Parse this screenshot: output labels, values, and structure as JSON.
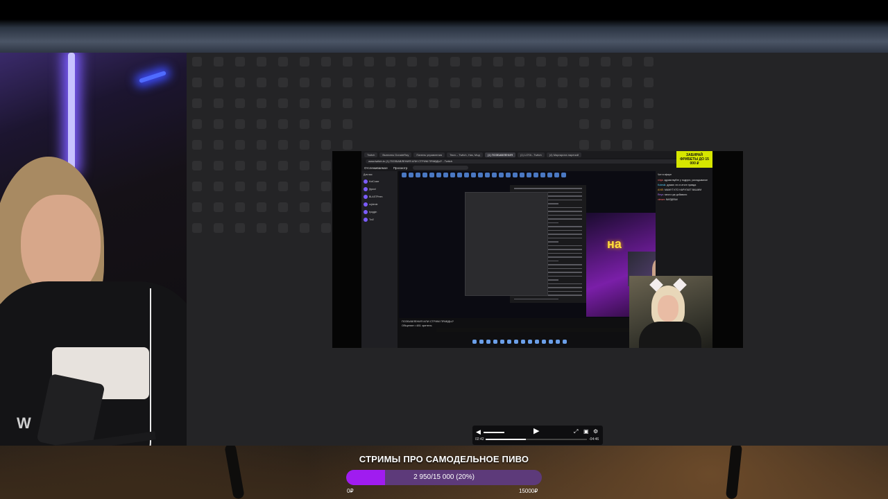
{
  "capture": {
    "tabs": [
      "Twitch",
      "Выплаты DonateRay",
      "Панель управления",
      "Твич – Twitch, Ник, Мод",
      "(1) ПОЗБАВЛЕНИЯ",
      "(1) LOTA - Twitch",
      "(4) Маргарита наречий"
    ],
    "url": "www.twitch.tv",
    "page_title": "(1) ПОЗБАВЛЕНИЯ ИЛИ СТРИМ ПРАВДЫ? - Twitch",
    "ad_text": "ЗАБИРАЙ ФРИБЕТЫ ДО 15 000 ₽",
    "nav": [
      "Отслеживаемое",
      "Просмотр"
    ],
    "sidebar_header": "Для вас",
    "sidebar_rows": [
      "KotCoser",
      "jfgood",
      "BLASTPrem",
      "rojdenie",
      "fyoggin",
      "Tor2"
    ],
    "neon_text": "на",
    "chat_header": "Чат в эфире",
    "chat": [
      {
        "user": "ninja",
        "text": "здравствуйте у подруги, разгадывание"
      },
      {
        "user": "Kolesik",
        "text": "думаю что в итоге правда"
      },
      {
        "user": "AXIE",
        "text": "МАМУТ КТО НАРУГАЕТ ВАШИМ"
      },
      {
        "user": "Reyn",
        "text": "много где добавили"
      },
      {
        "user": "viewer",
        "text": "ВАРДЕВА!"
      }
    ],
    "below_title": "ПОЗБАВЛЕНИЯ ИЛИ СТРИМ ПРАВДЫ?",
    "below_sub": "Общение • 481 зритель"
  },
  "player": {
    "time_current": "02:42",
    "time_total": "-04:46",
    "progress": 0.4
  },
  "goal": {
    "title": "СТРИМЫ ПРО САМОДЕЛЬНОЕ ПИВО",
    "progress_text": "2 950/15 000 (20%)",
    "percent": 20,
    "min_label": "0₽",
    "max_label": "15000₽",
    "fill_color": "#a01cf0",
    "track_color": "#5d3a7a"
  },
  "icons": [
    "volume-icon",
    "play-icon",
    "fullscreen-icon",
    "pip-icon",
    "settings-icon"
  ]
}
